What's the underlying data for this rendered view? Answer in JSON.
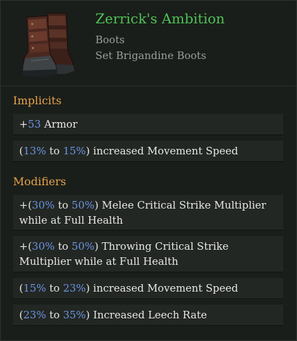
{
  "item": {
    "name": "Zerrick's Ambition",
    "type": "Boots",
    "base": "Set Brigandine Boots",
    "icon": "leather-boots-icon",
    "name_color": "#4fc256"
  },
  "implicits": {
    "title": "Implicits",
    "rows": [
      {
        "prefix": "+",
        "value": "53",
        "text": " Armor"
      },
      {
        "open": "(",
        "min": "13%",
        "to": " to ",
        "max": "15%",
        "close": ")",
        "text": " increased Movement Speed"
      }
    ]
  },
  "modifiers": {
    "title": "Modifiers",
    "rows": [
      {
        "open": "+(",
        "min": "30%",
        "to": " to ",
        "max": "50%",
        "close": ")",
        "text": " Melee Critical Strike Multiplier while at Full Health"
      },
      {
        "open": "+(",
        "min": "30%",
        "to": " to ",
        "max": "50%",
        "close": ")",
        "text": " Throwing Critical Strike Multiplier while at Full Health"
      },
      {
        "open": "(",
        "min": "15%",
        "to": " to ",
        "max": "23%",
        "close": ")",
        "text": " increased Movement Speed"
      },
      {
        "open": "(",
        "min": "23%",
        "to": " to ",
        "max": "35%",
        "close": ")",
        "text": " Increased Leech Rate"
      }
    ]
  },
  "colors": {
    "section_title": "#e6a34a",
    "value": "#6c94e6",
    "text": "#e8e8e4",
    "subtitle": "#9a9f9a",
    "row_bg": "#232723",
    "panel_bg": "#1a1e1a"
  }
}
